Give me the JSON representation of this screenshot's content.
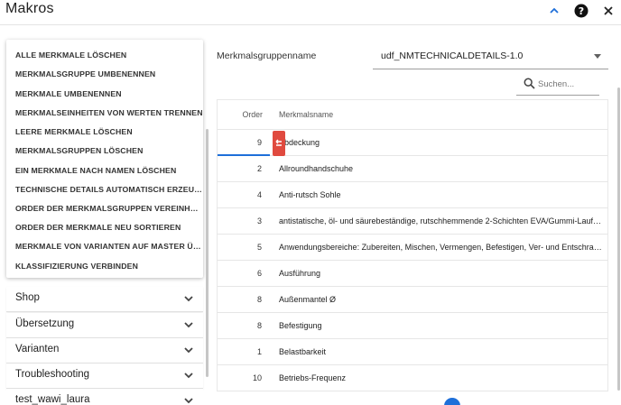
{
  "header": {
    "title": "Makros"
  },
  "icons": {
    "collapse": "chevron-up-icon",
    "help": "help-circle-icon",
    "close": "close-icon",
    "search": "search-icon",
    "chevron": "chevron-down-icon",
    "drag": "drag-handle-icon"
  },
  "colors": {
    "accent": "#1e6fd9",
    "drag_handle": "#e04a3f"
  },
  "macro_menu": {
    "items": [
      "ALLE MERKMALE LÖSCHEN",
      "MERKMALSGRUPPE UMBENENNEN",
      "MERKMALE UMBENENNEN",
      "MERKMALSEINHEITEN VON WERTEN TRENNEN",
      "LEERE MERKMALE LÖSCHEN",
      "MERKMALSGRUPPEN LÖSCHEN",
      "EIN MERKMALE NACH NAMEN LÖSCHEN",
      "TECHNISCHE DETAILS AUTOMATISCH ERZEUG...",
      "ORDER DER MERKMALSGRUPPEN VEREINHEITL...",
      "ORDER DER MERKMALE NEU SORTIEREN",
      "MERKMALE VON VARIANTEN AUF MASTER ÜBE...",
      "KLASSIFIZIERUNG VERBINDEN"
    ]
  },
  "left_panels": [
    "Shop",
    "Übersetzung",
    "Varianten",
    "Troubleshooting",
    "test_wawi_laura"
  ],
  "form": {
    "group_label": "Merkmalsgruppenname",
    "group_value": "udf_NMTECHNICALDETAILS-1.0",
    "search_placeholder": "Suchen..."
  },
  "table": {
    "columns": {
      "order": "Order",
      "name": "Merkmalsname"
    },
    "rows": [
      {
        "order": "9",
        "name": "Abdeckung"
      },
      {
        "order": "2",
        "name": "Allroundhandschuhe"
      },
      {
        "order": "4",
        "name": "Anti-rutsch Sohle"
      },
      {
        "order": "3",
        "name": "antistatische, öl- und säurebeständige, rutschhemmende 2-Schichten EVA/Gummi-Laufsohle"
      },
      {
        "order": "5",
        "name": "Anwendungsbereiche: Zubereiten, Mischen, Vermengen, Befestigen, Ver- und Entschrauben von..."
      },
      {
        "order": "6",
        "name": "Ausführung"
      },
      {
        "order": "8",
        "name": "Außenmantel Ø"
      },
      {
        "order": "8",
        "name": "Befestigung"
      },
      {
        "order": "1",
        "name": "Belastbarkeit"
      },
      {
        "order": "10",
        "name": "Betriebs-Frequenz"
      }
    ]
  }
}
